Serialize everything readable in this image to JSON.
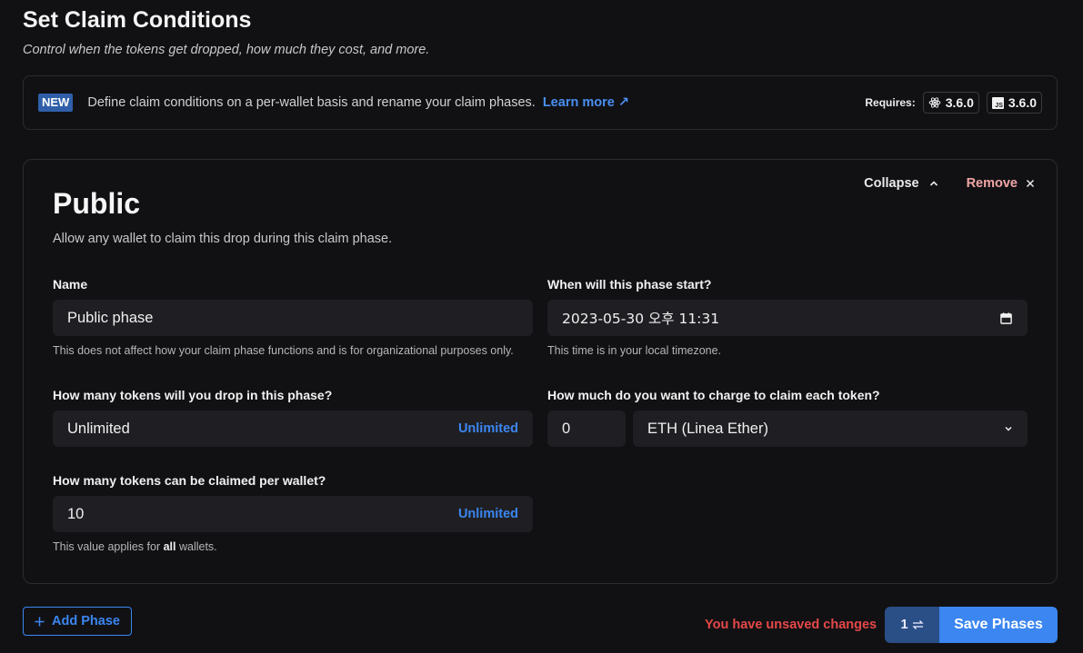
{
  "header": {
    "title": "Set Claim Conditions",
    "subtitle": "Control when the tokens get dropped, how much they cost, and more."
  },
  "banner": {
    "badge": "NEW",
    "text": "Define claim conditions on a per-wallet basis and rename your claim phases.",
    "link": "Learn more ↗",
    "requires_label": "Requires:",
    "react_version": "3.6.0",
    "js_version": "3.6.0",
    "js_icon_text": "JS"
  },
  "phase": {
    "title": "Public",
    "description": "Allow any wallet to claim this drop during this claim phase.",
    "collapse_label": "Collapse",
    "remove_label": "Remove",
    "name_field": {
      "label": "Name",
      "value": "Public phase",
      "helper": "This does not affect how your claim phase functions and is for organizational purposes only."
    },
    "start_field": {
      "label": "When will this phase start?",
      "value": "2023-05-30 오후 11:31",
      "helper": "This time is in your local timezone."
    },
    "drop_field": {
      "label": "How many tokens will you drop in this phase?",
      "value": "Unlimited",
      "suffix": "Unlimited"
    },
    "price_field": {
      "label": "How much do you want to charge to claim each token?",
      "value": "0",
      "currency": "ETH (Linea Ether)"
    },
    "per_wallet_field": {
      "label": "How many tokens can be claimed per wallet?",
      "value": "10",
      "suffix": "Unlimited",
      "helper_pre": "This value applies for ",
      "helper_bold": "all",
      "helper_post": " wallets."
    }
  },
  "footer": {
    "add_phase": "Add Phase",
    "unsaved": "You have unsaved changes",
    "change_count": "1",
    "save": "Save Phases"
  },
  "colors": {
    "accent": "#3b86f0",
    "danger": "#e54848",
    "background": "#111114"
  }
}
